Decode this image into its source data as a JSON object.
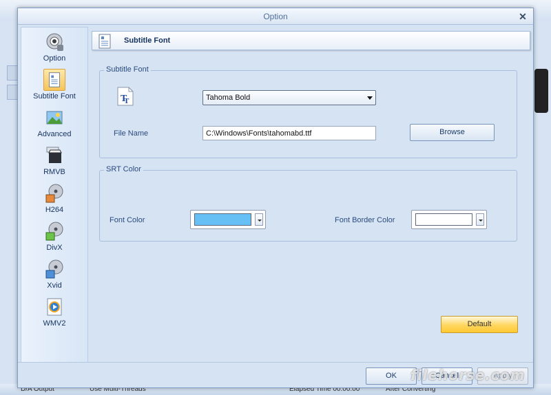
{
  "dialog": {
    "title": "Option",
    "close_glyph": "✕"
  },
  "sidebar": {
    "items": [
      {
        "label": "Option",
        "icon": "camera-gear-icon"
      },
      {
        "label": "Subtitle Font",
        "icon": "subtitle-doc-icon",
        "selected": true
      },
      {
        "label": "Advanced",
        "icon": "landscape-picture-icon"
      },
      {
        "label": "RMVB",
        "icon": "real-clapper-icon"
      },
      {
        "label": "H264",
        "icon": "film-reel-icon"
      },
      {
        "label": "DivX",
        "icon": "film-reel-icon"
      },
      {
        "label": "Xvid",
        "icon": "film-reel-icon"
      },
      {
        "label": "WMV2",
        "icon": "media-player-icon"
      }
    ]
  },
  "header": {
    "title": "Subtitle Font",
    "icon": "subtitle-doc-icon"
  },
  "subtitle_font_group": {
    "legend": "Subtitle Font",
    "font_select_value": "Tahoma Bold",
    "file_name_label": "File Name",
    "file_name_value": "C:\\Windows\\Fonts\\tahomabd.ttf",
    "browse_label": "Browse",
    "font_icon": "font-tt-icon"
  },
  "srt_color_group": {
    "legend": "SRT Color",
    "font_color_label": "Font Color",
    "font_color": "#66bff5",
    "font_border_color_label": "Font Border Color",
    "font_border_color": "#ffffff"
  },
  "buttons": {
    "default_label": "Default",
    "ok_label": "OK",
    "cancel_label": "Cancel",
    "apply_label": "Apply"
  },
  "watermark": "filehorse.com",
  "background_status": {
    "left_text": "D/A Output",
    "mid_text": "Use Multi-Threads",
    "right_text": "Elapsed Time 00:00:00",
    "far_text": "After Converting"
  },
  "colors": {
    "accent": "#ffd660",
    "panel": "#d6e3f3",
    "border": "#a8bddb"
  }
}
